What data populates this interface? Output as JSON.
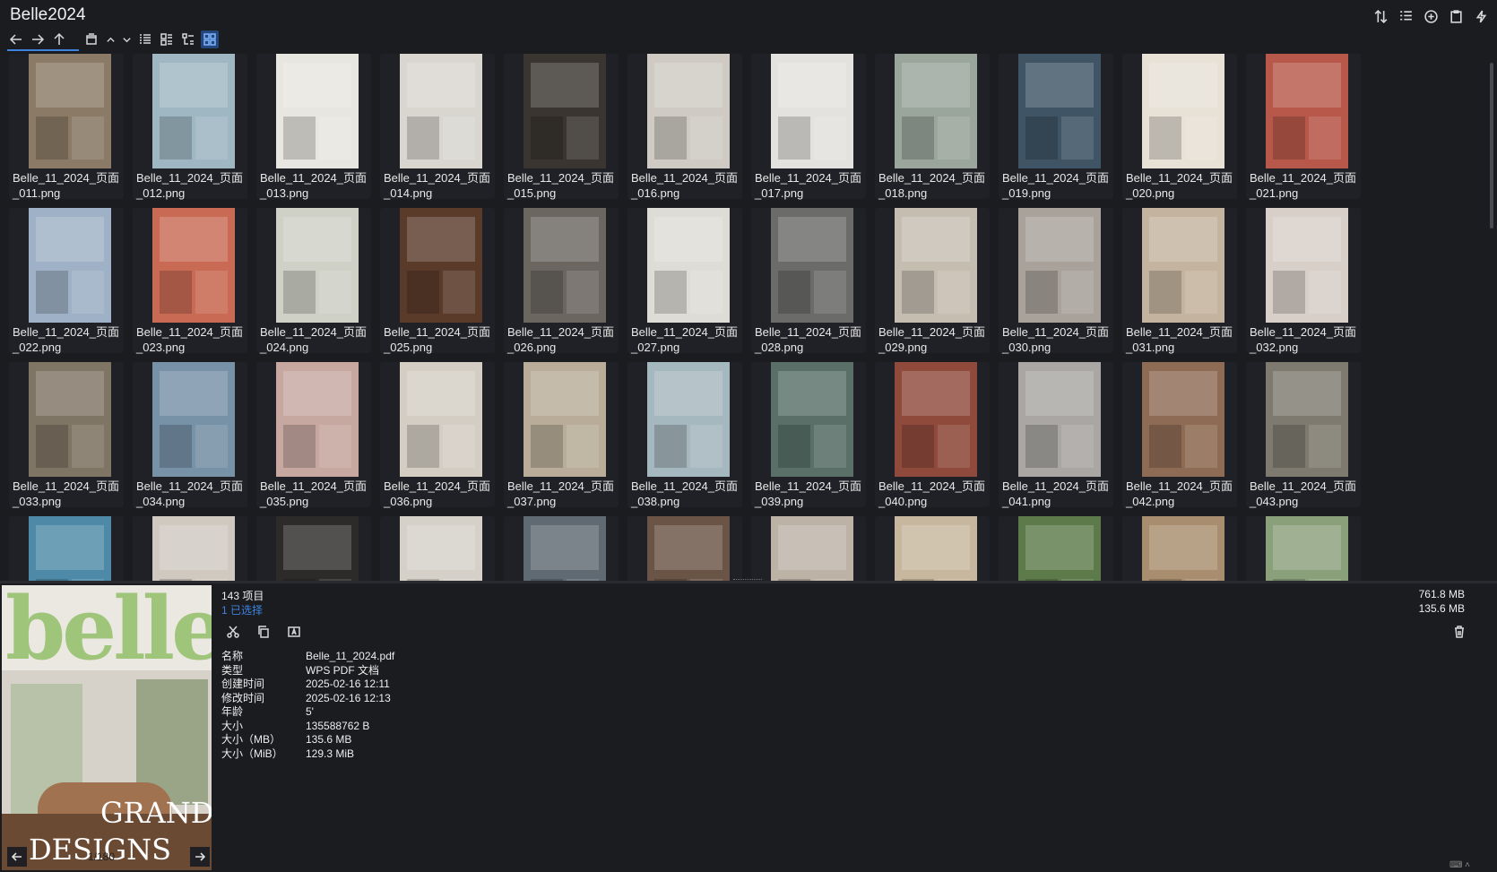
{
  "window": {
    "title": "Belle2024"
  },
  "toolbar": {
    "nav_icons": [
      "back-icon",
      "forward-icon",
      "up-icon",
      "window-icon",
      "chevron-up-icon",
      "chevron-down-icon",
      "details-view-icon",
      "list-view-icon",
      "tree-view-icon",
      "grid-view-icon"
    ],
    "right_icons": [
      "sort-icon",
      "list-options-icon",
      "add-icon",
      "clipboard-icon",
      "flash-icon"
    ]
  },
  "files": [
    {
      "line1": "Belle_11_2024_页面",
      "line2": "_011.png",
      "color": "#8a7a66"
    },
    {
      "line1": "Belle_11_2024_页面",
      "line2": "_012.png",
      "color": "#9fb7c2"
    },
    {
      "line1": "Belle_11_2024_页面",
      "line2": "_013.png",
      "color": "#e8e6e0"
    },
    {
      "line1": "Belle_11_2024_页面",
      "line2": "_014.png",
      "color": "#d9d6d0"
    },
    {
      "line1": "Belle_11_2024_页面",
      "line2": "_015.png",
      "color": "#3a3530"
    },
    {
      "line1": "Belle_11_2024_页面",
      "line2": "_016.png",
      "color": "#cfcac3"
    },
    {
      "line1": "Belle_11_2024_页面",
      "line2": "_017.png",
      "color": "#e3e2de"
    },
    {
      "line1": "Belle_11_2024_页面",
      "line2": "_018.png",
      "color": "#9aa59b"
    },
    {
      "line1": "Belle_11_2024_页面",
      "line2": "_019.png",
      "color": "#3f5566"
    },
    {
      "line1": "Belle_11_2024_页面",
      "line2": "_020.png",
      "color": "#e7e1d6"
    },
    {
      "line1": "Belle_11_2024_页面",
      "line2": "_021.png",
      "color": "#b8584b"
    },
    {
      "line1": "Belle_11_2024_页面",
      "line2": "_022.png",
      "color": "#9fb1c6"
    },
    {
      "line1": "Belle_11_2024_页面",
      "line2": "_023.png",
      "color": "#c96b54"
    },
    {
      "line1": "Belle_11_2024_页面",
      "line2": "_024.png",
      "color": "#cfd1c6"
    },
    {
      "line1": "Belle_11_2024_页面",
      "line2": "_025.png",
      "color": "#5a3b2a"
    },
    {
      "line1": "Belle_11_2024_页面",
      "line2": "_026.png",
      "color": "#6b6660"
    },
    {
      "line1": "Belle_11_2024_页面",
      "line2": "_027.png",
      "color": "#dedcd6"
    },
    {
      "line1": "Belle_11_2024_页面",
      "line2": "_028.png",
      "color": "#6b6b6a"
    },
    {
      "line1": "Belle_11_2024_页面",
      "line2": "_029.png",
      "color": "#c6bdb1"
    },
    {
      "line1": "Belle_11_2024_页面",
      "line2": "_030.png",
      "color": "#a8a29a"
    },
    {
      "line1": "Belle_11_2024_页面",
      "line2": "_031.png",
      "color": "#c4b49f"
    },
    {
      "line1": "Belle_11_2024_页面",
      "line2": "_032.png",
      "color": "#d8cfc8"
    },
    {
      "line1": "Belle_11_2024_页面",
      "line2": "_033.png",
      "color": "#7f7565"
    },
    {
      "line1": "Belle_11_2024_页面",
      "line2": "_034.png",
      "color": "#7791a6"
    },
    {
      "line1": "Belle_11_2024_页面",
      "line2": "_035.png",
      "color": "#c7a8a0"
    },
    {
      "line1": "Belle_11_2024_页面",
      "line2": "_036.png",
      "color": "#d4cdc4"
    },
    {
      "line1": "Belle_11_2024_页面",
      "line2": "_037.png",
      "color": "#b9ad99"
    },
    {
      "line1": "Belle_11_2024_页面",
      "line2": "_038.png",
      "color": "#a6b8bf"
    },
    {
      "line1": "Belle_11_2024_页面",
      "line2": "_039.png",
      "color": "#5a6f68"
    },
    {
      "line1": "Belle_11_2024_页面",
      "line2": "_040.png",
      "color": "#8f4a3c"
    },
    {
      "line1": "Belle_11_2024_页面",
      "line2": "_041.png",
      "color": "#a9a6a3"
    },
    {
      "line1": "Belle_11_2024_页面",
      "line2": "_042.png",
      "color": "#8e6b54"
    },
    {
      "line1": "Belle_11_2024_页面",
      "line2": "_043.png",
      "color": "#7e7a6f"
    },
    {
      "line1": "",
      "line2": "",
      "color": "#4e8aa8"
    },
    {
      "line1": "",
      "line2": "",
      "color": "#cfc9c0"
    },
    {
      "line1": "",
      "line2": "",
      "color": "#2c2b2a"
    },
    {
      "line1": "",
      "line2": "",
      "color": "#d5d0c8"
    },
    {
      "line1": "",
      "line2": "",
      "color": "#5f6a72"
    },
    {
      "line1": "",
      "line2": "",
      "color": "#6a5446"
    },
    {
      "line1": "",
      "line2": "",
      "color": "#bcb3a6"
    },
    {
      "line1": "",
      "line2": "",
      "color": "#c6b79e"
    },
    {
      "line1": "",
      "line2": "",
      "color": "#5d7a4a"
    },
    {
      "line1": "",
      "line2": "",
      "color": "#a88e6e"
    },
    {
      "line1": "",
      "line2": "",
      "color": "#8aa07a"
    }
  ],
  "details": {
    "item_count": "143 项目",
    "selected_count": "1 已选择",
    "total_size": "761.8 MB",
    "selected_size": "135.6 MB",
    "preview": {
      "logo": "belle",
      "grand": "GRAND",
      "designs": "DESIGNS",
      "page": "1/180"
    },
    "actions": [
      "cut-icon",
      "copy-icon",
      "rename-icon"
    ],
    "props": [
      {
        "k": "名称",
        "v": "Belle_11_2024.pdf"
      },
      {
        "k": "类型",
        "v": "WPS PDF 文档"
      },
      {
        "k": "创建时间",
        "v": "2025-02-16  12:11"
      },
      {
        "k": "修改时间",
        "v": "2025-02-16  12:13"
      },
      {
        "k": "年龄",
        "v": "5'"
      },
      {
        "k": "大小",
        "v": "135588762 B"
      },
      {
        "k": "大小（MB）",
        "v": "135.6 MB"
      },
      {
        "k": "大小（MiB）",
        "v": "129.3 MiB"
      }
    ]
  },
  "colors": {
    "accent": "#3d83e0",
    "background": "#1b1c20",
    "cell": "#202126"
  }
}
